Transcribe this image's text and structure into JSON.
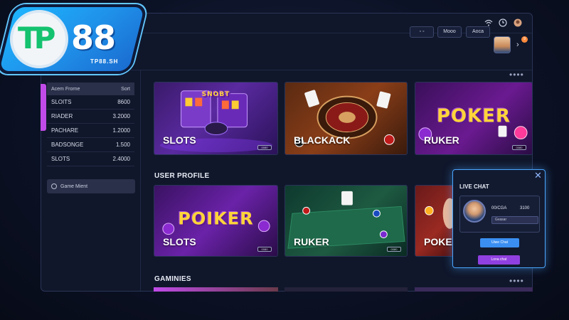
{
  "brand": {
    "logo_main": "88",
    "logo_tp": "TP",
    "logo_sub": "TP88.SH"
  },
  "topbar": {
    "icons": [
      "wifi-icon",
      "timer-icon",
      "profile-icon"
    ]
  },
  "header": {
    "toggle_label": "◦ ◦",
    "mode_button": "Mooo",
    "account_button": "Aoca",
    "notification_count": "9"
  },
  "sidebar": {
    "table_header": {
      "left": "Acem Frorne",
      "right": "Sort"
    },
    "rows": [
      {
        "name": "SLOITS",
        "value": "8600"
      },
      {
        "name": "RIADER",
        "value": "3.2000"
      },
      {
        "name": "PACHARE",
        "value": "1.2000"
      },
      {
        "name": "BADSONGE",
        "value": "1.500"
      },
      {
        "name": "SLOTS",
        "value": "2.4000"
      }
    ],
    "game_management": "Game Mient"
  },
  "sections": {
    "user_profile": "USER PROFILE",
    "gaminies": "GAMINIES"
  },
  "cards_row1": [
    {
      "title": "SLOTS",
      "logo": "SNOBT",
      "tag": "0080"
    },
    {
      "title": "BLACKACK",
      "logo": "",
      "tag": ""
    },
    {
      "title": "RUKER",
      "logo": "POKER",
      "tag": "0080"
    }
  ],
  "cards_row2": [
    {
      "title": "SLOTS",
      "logo": "POIKER",
      "tag": "0080"
    },
    {
      "title": "RUKER",
      "logo": "",
      "tag": "0080"
    },
    {
      "title": "POKE",
      "logo": "",
      "tag": ""
    }
  ],
  "live_chat": {
    "title": "LIVE CHAT",
    "user_name": "00/CGA",
    "amount": "3100",
    "field_text": "Gvasar",
    "primary_button": "Uiwe Chat",
    "secondary_button": "Lona chat"
  },
  "colors": {
    "accent_purple": "#c04be8",
    "chat_blue": "#4aa6ff",
    "brand_blue": "#1f8fe8",
    "brand_green": "#14c26f",
    "logo_gold": "#ffd43a"
  }
}
